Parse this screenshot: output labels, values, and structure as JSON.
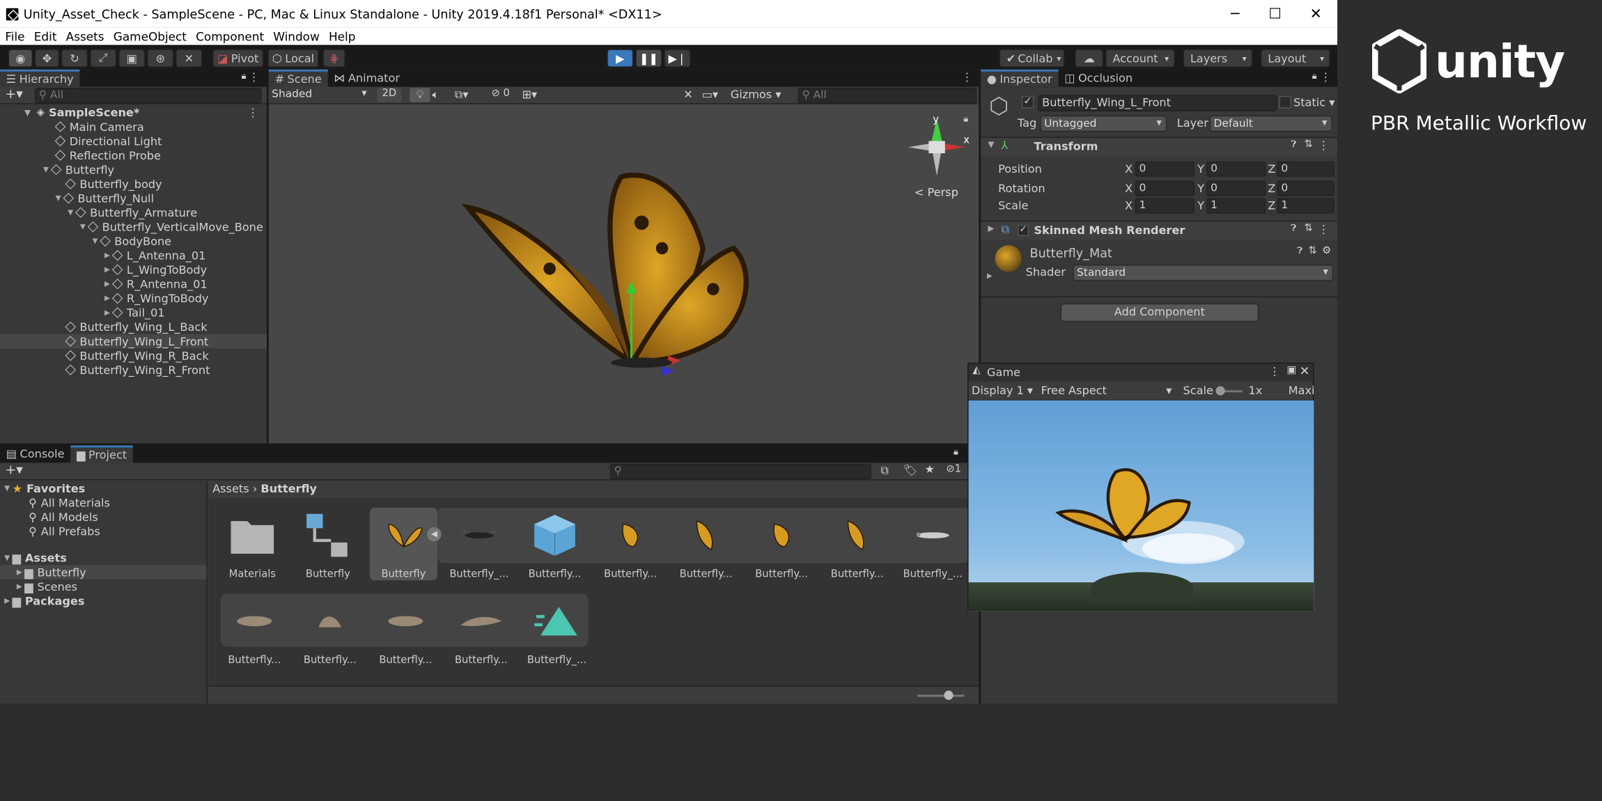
{
  "titlebar": {
    "title": "Unity_Asset_Check - SampleScene - PC, Mac & Linux Standalone - Unity 2019.4.18f1 Personal* <DX11>",
    "minimize": "─",
    "maximize": "☐",
    "close": "✕"
  },
  "menu": [
    "File",
    "Edit",
    "Assets",
    "GameObject",
    "Component",
    "Window",
    "Help"
  ],
  "toolbar": {
    "pivot": "Pivot",
    "local": "Local",
    "collab": "Collab",
    "account": "Account",
    "layers": "Layers",
    "layout": "Layout"
  },
  "hierarchy": {
    "tab": "Hierarchy",
    "search_placeholder": "All",
    "items": [
      {
        "label": "SampleScene*"
      },
      {
        "label": "Main Camera"
      },
      {
        "label": "Directional Light"
      },
      {
        "label": "Reflection Probe"
      },
      {
        "label": "Butterfly"
      },
      {
        "label": "Butterfly_body"
      },
      {
        "label": "Butterfly_Null"
      },
      {
        "label": "Butterfly_Armature"
      },
      {
        "label": "Butterfly_VerticalMove_Bone"
      },
      {
        "label": "BodyBone"
      },
      {
        "label": "L_Antenna_01"
      },
      {
        "label": "L_WingToBody"
      },
      {
        "label": "R_Antenna_01"
      },
      {
        "label": "R_WingToBody"
      },
      {
        "label": "Tail_01"
      },
      {
        "label": "Butterfly_Wing_L_Back"
      },
      {
        "label": "Butterfly_Wing_L_Front"
      },
      {
        "label": "Butterfly_Wing_R_Back"
      },
      {
        "label": "Butterfly_Wing_R_Front"
      }
    ]
  },
  "scene": {
    "tabs": [
      "Scene",
      "Animator"
    ],
    "shading": "Shaded",
    "mode2d": "2D",
    "hidden_count": "0",
    "gizmos": "Gizmos",
    "search_placeholder": "All",
    "persp": "Persp",
    "axis_y": "y",
    "axis_x": "x"
  },
  "inspector": {
    "tabs": [
      "Inspector",
      "Occlusion"
    ],
    "object_name": "Butterfly_Wing_L_Front",
    "static": "Static",
    "tag_label": "Tag",
    "tag_value": "Untagged",
    "layer_label": "Layer",
    "layer_value": "Default",
    "transform": {
      "title": "Transform",
      "rows": [
        {
          "label": "Position",
          "x": "0",
          "y": "0",
          "z": "0"
        },
        {
          "label": "Rotation",
          "x": "0",
          "y": "0",
          "z": "0"
        },
        {
          "label": "Scale",
          "x": "1",
          "y": "1",
          "z": "1"
        }
      ],
      "axis_x": "X",
      "axis_y": "Y",
      "axis_z": "Z"
    },
    "renderer_title": "Skinned Mesh Renderer",
    "material_name": "Butterfly_Mat",
    "shader_label": "Shader",
    "shader_value": "Standard",
    "add_component": "Add Component"
  },
  "game": {
    "tab": "Game",
    "display": "Display 1",
    "aspect": "Free Aspect",
    "scale_label": "Scale",
    "scale_value": "1x",
    "maximize": "Maxi"
  },
  "project": {
    "tabs": [
      "Console",
      "Project"
    ],
    "favorites_label": "Favorites",
    "favorites": [
      "All Materials",
      "All Models",
      "All Prefabs"
    ],
    "assets_label": "Assets",
    "assets_children": [
      "Butterfly",
      "Scenes"
    ],
    "packages_label": "Packages",
    "breadcrumb": [
      "Assets",
      "Butterfly"
    ],
    "hidden_count": "1",
    "row1": [
      "Materials",
      "Butterfly",
      "Butterfly",
      "Butterfly_...",
      "Butterfly...",
      "Butterfly...",
      "Butterfly...",
      "Butterfly...",
      "Butterfly...",
      "Butterfly_..."
    ],
    "row2": [
      "Butterfly...",
      "Butterfly...",
      "Butterfly...",
      "Butterfly...",
      "Butterfly_..."
    ]
  },
  "brand": {
    "logo_text": "unity",
    "subtitle": "PBR Metallic Workflow"
  },
  "colors": {
    "accent": "#3a79bb",
    "panel": "#383838",
    "background": "#2d2d2d"
  }
}
